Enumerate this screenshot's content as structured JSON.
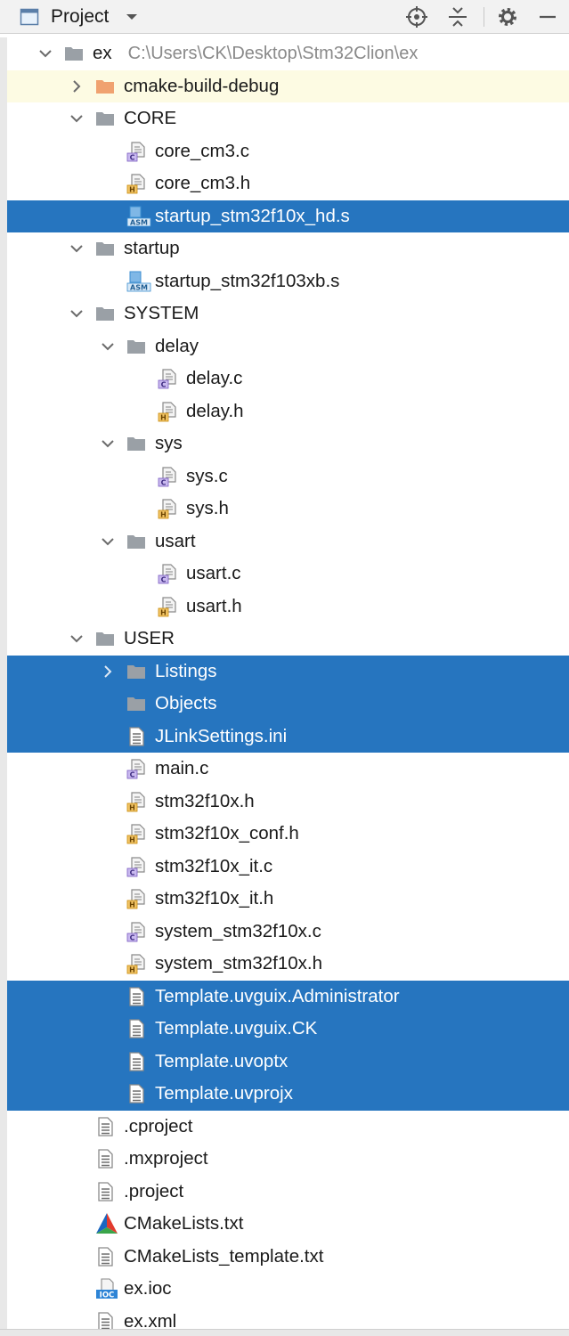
{
  "header": {
    "title": "Project",
    "icons": [
      "project-view-icon",
      "dropdown-arrow-icon",
      "locate-icon",
      "collapse-all-icon",
      "gear-icon",
      "minimize-icon"
    ]
  },
  "colors": {
    "selection": "#2675bf",
    "hover": "#fdfbe3",
    "folder": "#9aa0a6",
    "excluded_folder": "#f0a270",
    "c_badge": "#7b5cc2",
    "h_badge": "#e3a01b",
    "asm_badge": "#3b8ed0"
  },
  "tree": {
    "root_path": "C:\\Users\\CK\\Desktop\\Stm32Clion\\ex",
    "rows": [
      {
        "label": "ex",
        "depth": 0,
        "icon": "folder",
        "arrow": "down",
        "state": ""
      },
      {
        "label": "cmake-build-debug",
        "depth": 1,
        "icon": "folder-orange",
        "arrow": "right",
        "state": "hover"
      },
      {
        "label": "CORE",
        "depth": 1,
        "icon": "folder",
        "arrow": "down",
        "state": ""
      },
      {
        "label": "core_cm3.c",
        "depth": 2,
        "icon": "c-file",
        "arrow": "",
        "state": ""
      },
      {
        "label": "core_cm3.h",
        "depth": 2,
        "icon": "h-file",
        "arrow": "",
        "state": ""
      },
      {
        "label": "startup_stm32f10x_hd.s",
        "depth": 2,
        "icon": "asm-file",
        "arrow": "",
        "state": "selected"
      },
      {
        "label": "startup",
        "depth": 1,
        "icon": "folder",
        "arrow": "down",
        "state": ""
      },
      {
        "label": "startup_stm32f103xb.s",
        "depth": 2,
        "icon": "asm-file",
        "arrow": "",
        "state": ""
      },
      {
        "label": "SYSTEM",
        "depth": 1,
        "icon": "folder",
        "arrow": "down",
        "state": ""
      },
      {
        "label": "delay",
        "depth": 2,
        "icon": "folder",
        "arrow": "down",
        "state": ""
      },
      {
        "label": "delay.c",
        "depth": 3,
        "icon": "c-file",
        "arrow": "",
        "state": ""
      },
      {
        "label": "delay.h",
        "depth": 3,
        "icon": "h-file",
        "arrow": "",
        "state": ""
      },
      {
        "label": "sys",
        "depth": 2,
        "icon": "folder",
        "arrow": "down",
        "state": ""
      },
      {
        "label": "sys.c",
        "depth": 3,
        "icon": "c-file",
        "arrow": "",
        "state": ""
      },
      {
        "label": "sys.h",
        "depth": 3,
        "icon": "h-file",
        "arrow": "",
        "state": ""
      },
      {
        "label": "usart",
        "depth": 2,
        "icon": "folder",
        "arrow": "down",
        "state": ""
      },
      {
        "label": "usart.c",
        "depth": 3,
        "icon": "c-file",
        "arrow": "",
        "state": ""
      },
      {
        "label": "usart.h",
        "depth": 3,
        "icon": "h-file",
        "arrow": "",
        "state": ""
      },
      {
        "label": "USER",
        "depth": 1,
        "icon": "folder",
        "arrow": "down",
        "state": ""
      },
      {
        "label": "Listings",
        "depth": 2,
        "icon": "folder",
        "arrow": "right",
        "state": "selected"
      },
      {
        "label": "Objects",
        "depth": 2,
        "icon": "folder",
        "arrow": "",
        "state": "selected"
      },
      {
        "label": "JLinkSettings.ini",
        "depth": 2,
        "icon": "text-file",
        "arrow": "",
        "state": "selected"
      },
      {
        "label": "main.c",
        "depth": 2,
        "icon": "c-file",
        "arrow": "",
        "state": ""
      },
      {
        "label": "stm32f10x.h",
        "depth": 2,
        "icon": "h-file",
        "arrow": "",
        "state": ""
      },
      {
        "label": "stm32f10x_conf.h",
        "depth": 2,
        "icon": "h-file",
        "arrow": "",
        "state": ""
      },
      {
        "label": "stm32f10x_it.c",
        "depth": 2,
        "icon": "c-file",
        "arrow": "",
        "state": ""
      },
      {
        "label": "stm32f10x_it.h",
        "depth": 2,
        "icon": "h-file",
        "arrow": "",
        "state": ""
      },
      {
        "label": "system_stm32f10x.c",
        "depth": 2,
        "icon": "c-file",
        "arrow": "",
        "state": ""
      },
      {
        "label": "system_stm32f10x.h",
        "depth": 2,
        "icon": "h-file",
        "arrow": "",
        "state": ""
      },
      {
        "label": "Template.uvguix.Administrator",
        "depth": 2,
        "icon": "text-file",
        "arrow": "",
        "state": "selected"
      },
      {
        "label": "Template.uvguix.CK",
        "depth": 2,
        "icon": "text-file",
        "arrow": "",
        "state": "selected"
      },
      {
        "label": "Template.uvoptx",
        "depth": 2,
        "icon": "text-file",
        "arrow": "",
        "state": "selected"
      },
      {
        "label": "Template.uvprojx",
        "depth": 2,
        "icon": "text-file",
        "arrow": "",
        "state": "selected"
      },
      {
        "label": ".cproject",
        "depth": 1,
        "icon": "text-file",
        "arrow": "",
        "state": ""
      },
      {
        "label": ".mxproject",
        "depth": 1,
        "icon": "text-file",
        "arrow": "",
        "state": ""
      },
      {
        "label": ".project",
        "depth": 1,
        "icon": "text-file",
        "arrow": "",
        "state": ""
      },
      {
        "label": "CMakeLists.txt",
        "depth": 1,
        "icon": "cmake-file",
        "arrow": "",
        "state": ""
      },
      {
        "label": "CMakeLists_template.txt",
        "depth": 1,
        "icon": "text-file",
        "arrow": "",
        "state": ""
      },
      {
        "label": "ex.ioc",
        "depth": 1,
        "icon": "ioc-file",
        "arrow": "",
        "state": ""
      },
      {
        "label": "ex.xml",
        "depth": 1,
        "icon": "text-file",
        "arrow": "",
        "state": ""
      }
    ]
  }
}
